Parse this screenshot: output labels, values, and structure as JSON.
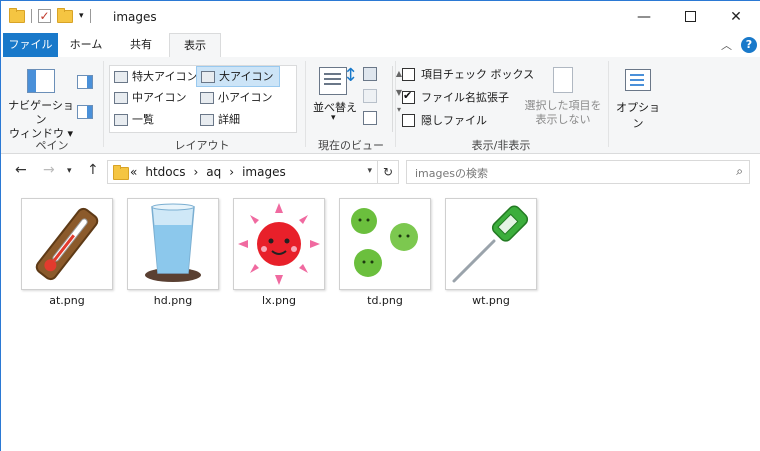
{
  "window": {
    "title": "images"
  },
  "tabs": {
    "file": "ファイル",
    "home": "ホーム",
    "share": "共有",
    "view": "表示"
  },
  "ribbon": {
    "nav_pane": {
      "line1": "ナビゲーション",
      "line2": "ウィンドウ ▾"
    },
    "pane_group": "ペイン",
    "layout_items": [
      "特大アイコン",
      "大アイコン",
      "中アイコン",
      "小アイコン",
      "一覧",
      "詳細"
    ],
    "layout_selected": "大アイコン",
    "layout_group": "レイアウト",
    "sort_label": "並べ替え",
    "current_view_group": "現在のビュー",
    "checkbox_item": "項目チェック ボックス",
    "checkbox_ext": "ファイル名拡張子",
    "checkbox_hidden": "隠しファイル",
    "hide_selected": {
      "line1": "選択した項目を",
      "line2": "表示しない"
    },
    "showhide_group": "表示/非表示",
    "options": "オプション"
  },
  "address": {
    "prefix": "«",
    "crumbs": [
      "htdocs",
      "aq",
      "images"
    ]
  },
  "search": {
    "placeholder": "imagesの検索"
  },
  "files": [
    "at.png",
    "hd.png",
    "lx.png",
    "td.png",
    "wt.png"
  ],
  "colors": {
    "accent": "#1979ca",
    "selected": "#cce4f7",
    "folder": "#f5c542"
  }
}
